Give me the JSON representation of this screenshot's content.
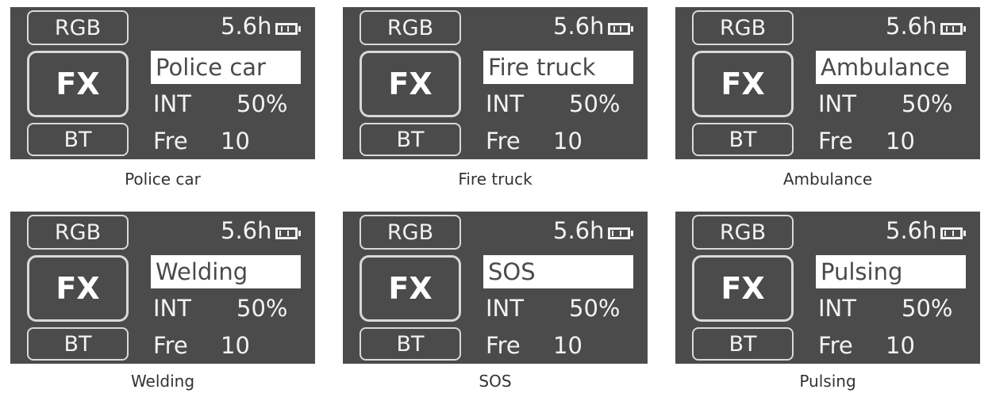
{
  "screens": [
    {
      "rgb_label": "RGB",
      "fx_label": "FX",
      "bt_label": "BT",
      "battery_time": "5.6h",
      "battery_icon": "battery-icon",
      "mode": "Police car",
      "int_label": "INT",
      "int_value": "50%",
      "fre_label": "Fre",
      "fre_value": "10",
      "caption": "Police car"
    },
    {
      "rgb_label": "RGB",
      "fx_label": "FX",
      "bt_label": "BT",
      "battery_time": "5.6h",
      "battery_icon": "battery-icon",
      "mode": "Fire truck",
      "int_label": "INT",
      "int_value": "50%",
      "fre_label": "Fre",
      "fre_value": "10",
      "caption": "Fire truck"
    },
    {
      "rgb_label": "RGB",
      "fx_label": "FX",
      "bt_label": "BT",
      "battery_time": "5.6h",
      "battery_icon": "battery-icon",
      "mode": "Ambulance",
      "int_label": "INT",
      "int_value": "50%",
      "fre_label": "Fre",
      "fre_value": "10",
      "caption": "Ambulance"
    },
    {
      "rgb_label": "RGB",
      "fx_label": "FX",
      "bt_label": "BT",
      "battery_time": "5.6h",
      "battery_icon": "battery-icon",
      "mode": "Welding",
      "int_label": "INT",
      "int_value": "50%",
      "fre_label": "Fre",
      "fre_value": "10",
      "caption": "Welding"
    },
    {
      "rgb_label": "RGB",
      "fx_label": "FX",
      "bt_label": "BT",
      "battery_time": "5.6h",
      "battery_icon": "battery-icon",
      "mode": "SOS",
      "int_label": "INT",
      "int_value": "50%",
      "fre_label": "Fre",
      "fre_value": "10",
      "caption": "SOS"
    },
    {
      "rgb_label": "RGB",
      "fx_label": "FX",
      "bt_label": "BT",
      "battery_time": "5.6h",
      "battery_icon": "battery-icon",
      "mode": "Pulsing",
      "int_label": "INT",
      "int_value": "50%",
      "fre_label": "Fre",
      "fre_value": "10",
      "caption": "Pulsing"
    }
  ],
  "colors": {
    "screen_background": "#4b4b4b",
    "screen_text": "#f2f2f2",
    "mode_highlight": "#ffffff",
    "caption_text": "#333333"
  }
}
